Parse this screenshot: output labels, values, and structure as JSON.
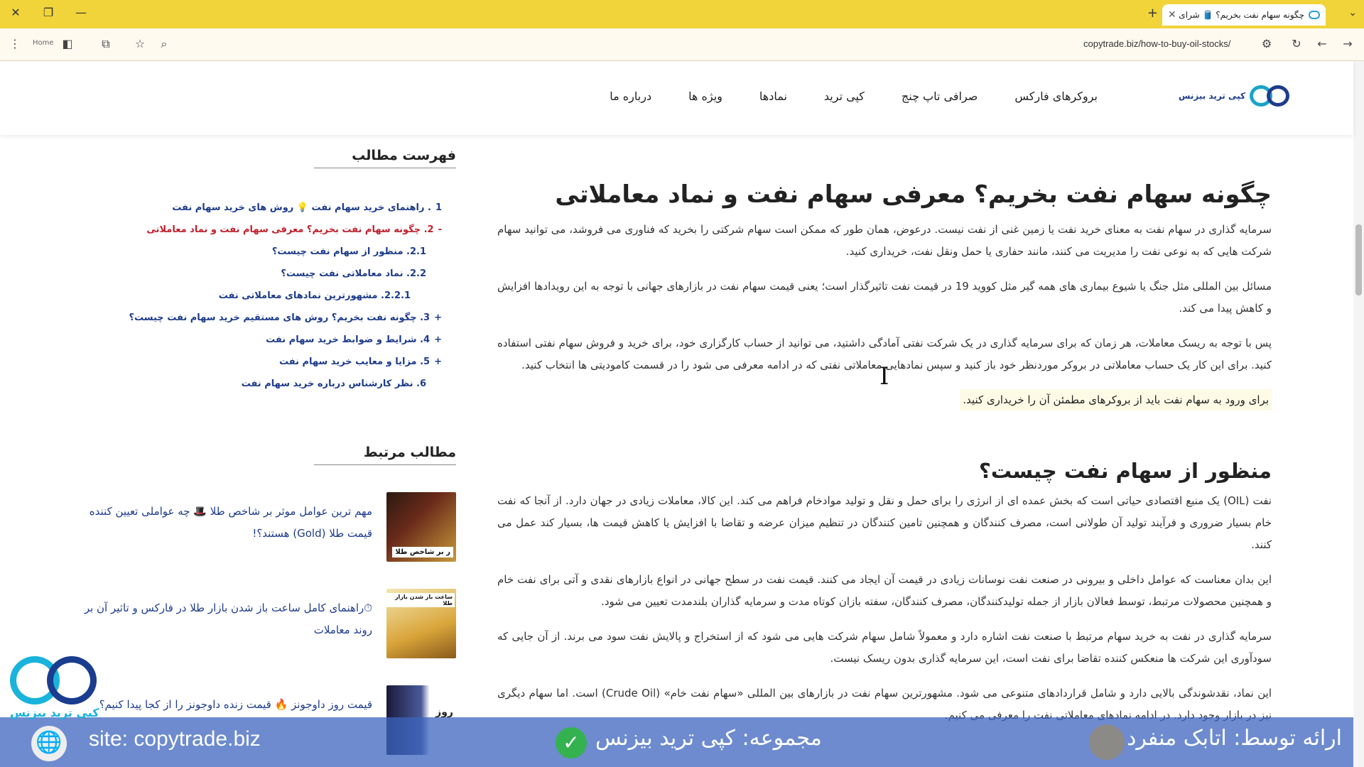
{
  "browser": {
    "tab_title": "چگونه سهام نفت بخریم؟ 🛢️ شرای",
    "url": "copytrade.biz/how-to-buy-oil-stocks/",
    "profile_label": "Home"
  },
  "header": {
    "logo_text": "کپی ترید بیزنس",
    "nav": [
      "بروکرهای فارکس",
      "صرافی تاپ چنج",
      "کپی ترید",
      "نمادها",
      "ویژه ها",
      "درباره ما"
    ]
  },
  "article": {
    "h1": "چگونه سهام نفت بخریم؟ معرفی سهام نفت و نماد معاملاتی",
    "p1": "سرمایه گذاری در سهام نفت به معنای خرید نفت یا زمین غنی از نفت نیست. درعوض، همان طور که ممکن است سهام شرکتی را بخرید که فناوری می فروشد، می توانید سهام شرکت هایی که به نوعی نفت را مدیریت می کنند، مانند حفاری یا حمل ونقل نفت، خریداری کنید.",
    "p2": "مسائل بین المللی مثل جنگ یا شیوع بیماری های همه گیر مثل کووید 19 در قیمت نفت تاثیرگذار است؛ یعنی قیمت سهام نفت در بازارهای جهانی با توجه به این رویدادها افزایش و کاهش پیدا می کند.",
    "p3": "پس با توجه به ریسک معاملات، هر زمان که برای سرمایه گذاری در یک شرکت نفتی آمادگی داشتید، می توانید از حساب کارگزاری خود، برای خرید و فروش سهام نفتی استفاده کنید. برای این کار یک حساب معاملاتی در بروکر موردنظر خود باز کنید و سپس نمادهایی معاملاتی نفتی که در ادامه معرفی می شود را در قسمت کامودیتی ها انتخاب کنید.",
    "highlight": "برای ورود به سهام نفت باید از بروکرهای مطمئن آن را خریداری کنید.",
    "h2": "منظور از سهام نفت چیست؟",
    "p4": "نفت (OIL) یک منبع اقتصادی حیاتی است که بخش عمده ای از انرژی را برای حمل و نقل و تولید موادخام فراهم می کند. این کالا، معاملات زیادی در جهان دارد. از آنجا که نفت خام بسیار ضروری و فرآیند تولید آن طولانی است، مصرف کنندگان و همچنین تامین کنندگان در تنظیم میزان عرضه و تقاضا با افزایش یا کاهش قیمت ها، بسیار کند عمل می کنند.",
    "p5": "این بدان معناست که عوامل داخلی و بیرونی در صنعت نفت نوسانات زیادی در قیمت آن ایجاد می کنند. قیمت نفت در سطح جهانی در انواع بازارهای نقدی و آتی برای نفت خام و همچنین محصولات مرتبط، توسط فعالان بازار از جمله تولیدکنندگان، مصرف کنندگان، سفته بازان کوتاه مدت و سرمایه گذاران بلندمدت تعیین می شود.",
    "p6": "سرمایه گذاری در نفت به خرید سهام مرتبط با صنعت نفت اشاره دارد و معمولاً شامل سهام شرکت هایی می شود که از استخراج و پالایش نفت سود می برند. از آن جایی که سودآوری این شرکت ها منعکس کننده تقاضا برای نفت است، این سرمایه گذاری بدون ریسک نیست.",
    "p7": "این نماد، نقدشوندگی بالایی دارد و شامل قراردادهای متنوعی می شود. مشهورترین سهام نفت در بازارهای بین المللی «سهام نفت خام» (Crude Oil) است. اما سهام دیگری نیز در بازار وجود دارد. در ادامه نمادهای معاملاتی نفت را معرفی می کنیم."
  },
  "sidebar": {
    "toc_title": "فهرست مطالب",
    "toc": [
      {
        "label": "1. راهنمای خرید سهام نفت 💡 روش های خرید سهام نفت",
        "marker": ""
      },
      {
        "label": "2. چگونه سهام نفت بخریم؟ معرفی سهام نفت و نماد معاملاتی",
        "marker": "-"
      },
      {
        "label": "2.1. منظور از سهام نفت چیست؟",
        "marker": ""
      },
      {
        "label": "2.2. نماد معاملاتی نفت چیست؟",
        "marker": ""
      },
      {
        "label": "2.2.1. مشهورترین نمادهای معاملاتی نفت",
        "marker": ""
      },
      {
        "label": "3. چگونه نفت بخریم؟ روش های مستقیم خرید سهام نفت چیست؟",
        "marker": "+"
      },
      {
        "label": "4. شرایط و ضوابط خرید سهام نفت",
        "marker": "+"
      },
      {
        "label": "5. مزایا و معایب خرید سهام نفت",
        "marker": "+"
      },
      {
        "label": "6. نظر کارشناس درباره خرید سهام نفت",
        "marker": ""
      }
    ],
    "related_title": "مطالب مرتبط",
    "related": [
      {
        "text": "مهم ترین عوامل موثر بر شاخص طلا 🎩 چه عواملی تعیین کننده قیمت طلا (Gold) هستند؟!",
        "thumb_caption": "ر بر شاخص طلا"
      },
      {
        "text": "⏱راهنمای کامل ساعت باز شدن بازار طلا در فارکس و تاثیر آن بر روند معاملات",
        "thumb_caption": "ساعت باز شدن بازار طلا"
      },
      {
        "text": "قیمت روز داوجونز 🔥 قیمت زنده داوجونز را از کجا پیدا کنیم؟",
        "thumb_caption": "روز"
      }
    ]
  },
  "overlay": {
    "site": "site: copytrade.biz",
    "group": "مجموعه: کپی ترید بیزنس",
    "presenter": "ارائه توسط: اتابک منفرد",
    "float_logo_text": "کپی ترید بیزنس"
  },
  "colors": {
    "browser_bar": "#f0d43a",
    "link": "#1e3c8c",
    "active_toc": "#c0202c",
    "brand_cyan": "#1aa3c8"
  }
}
